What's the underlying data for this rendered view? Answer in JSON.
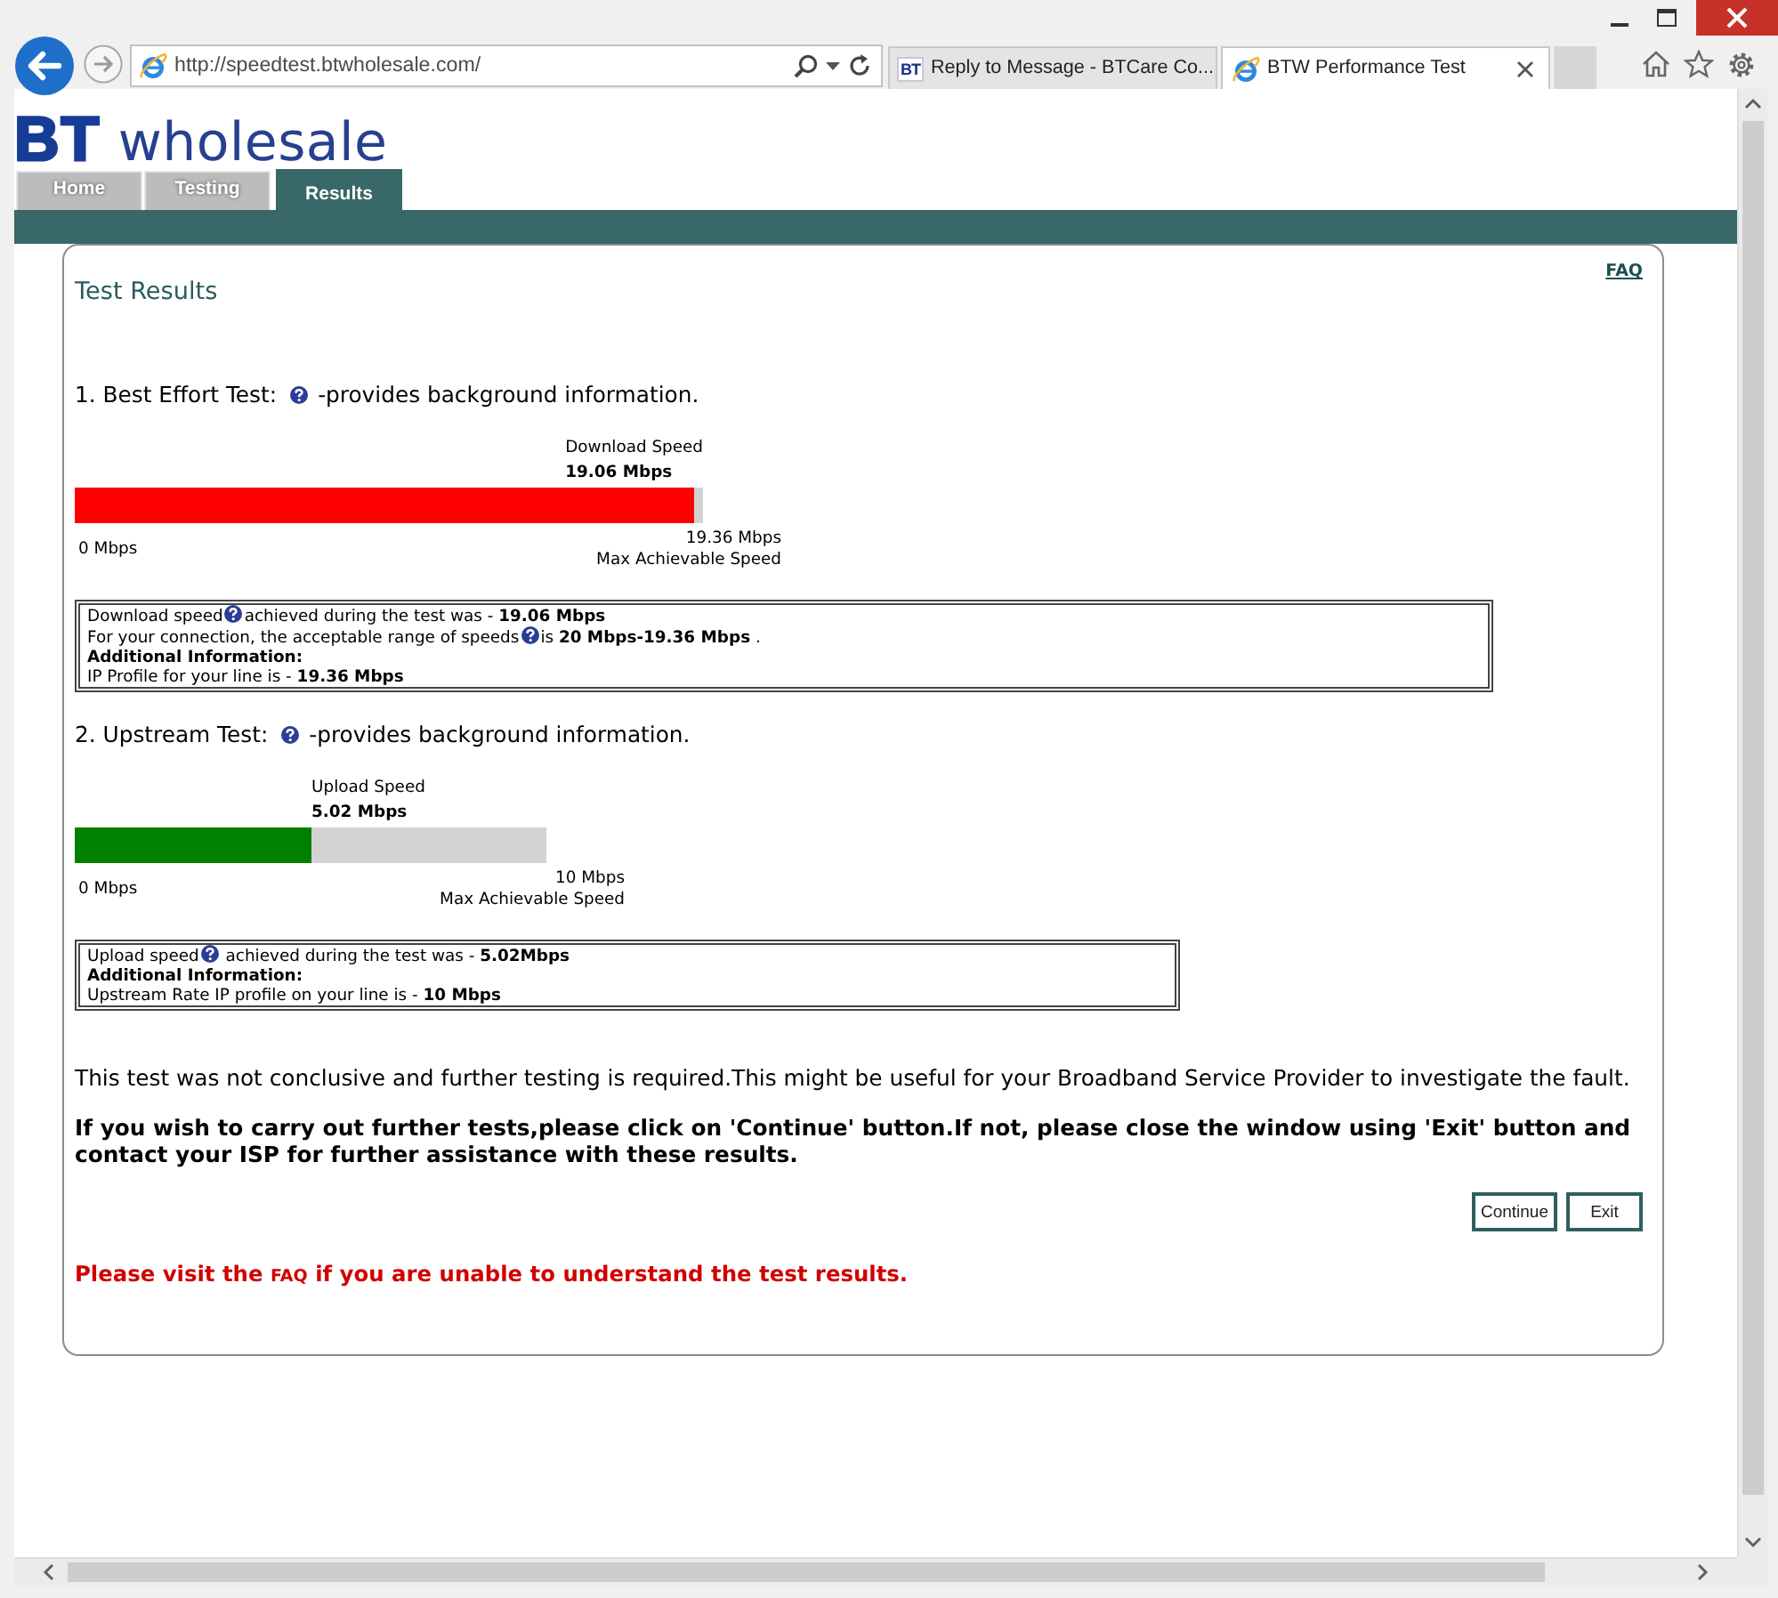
{
  "browser": {
    "address": "http://speedtest.btwholesale.com/",
    "tabs": [
      {
        "favicon": {
          "kind": "text",
          "text": "BT"
        },
        "title": "Reply to Message - BTCare Co...",
        "selected": false
      },
      {
        "favicon": {
          "kind": "browser"
        },
        "title": "BTW Performance Test",
        "selected": true
      }
    ]
  },
  "page": {
    "logo": "**BT** wholesale",
    "nav_tabs": [
      {
        "label": "Home",
        "selected": false
      },
      {
        "label": "Testing",
        "selected": false
      },
      {
        "label": "Results",
        "selected": true
      }
    ],
    "faq_link": "FAQ",
    "title": "Test Results",
    "tests": [
      {
        "heading": "1. Best Effort Test:",
        "description": "-provides background information.",
        "meter": {
          "label": "Download Speed",
          "value": "19.06 Mbps",
          "level": 0.985,
          "color": "#ff0000",
          "min_label": "0 Mbps",
          "max_label": "19.36 Mbps",
          "max_caption": "Max Achievable Speed"
        },
        "details": [
          {
            "kind": "help",
            "before": "Download speed",
            "after": "achieved during the test was - **19.06 Mbps**"
          },
          {
            "kind": "help",
            "before": "For your connection, the acceptable range of speeds",
            "after": "is **20 Mbps-19.36 Mbps** ."
          },
          {
            "kind": "heading",
            "text": "Additional Information:"
          },
          {
            "kind": "plain",
            "text": "IP Profile for your line is - **19.36 Mbps**"
          }
        ]
      },
      {
        "heading": "2. Upstream Test:",
        "description": "-provides background information.",
        "meter": {
          "label": "Upload Speed",
          "value": "5.02 Mbps",
          "level": 0.502,
          "color": "#008000",
          "min_label": "0 Mbps",
          "max_label": "10 Mbps",
          "max_caption": "Max Achievable Speed"
        },
        "details": [
          {
            "kind": "help",
            "before": "Upload speed",
            "after": " achieved during the test was - **5.02Mbps**"
          },
          {
            "kind": "heading",
            "text": "Additional Information:"
          },
          {
            "kind": "plain",
            "text": "Upstream Rate IP profile on your line is - **10 Mbps**"
          }
        ]
      }
    ],
    "conclusion": "This test was not conclusive and further testing is required.This might be useful for your Broadband Service Provider to investigate the fault.",
    "instruction": "If you wish to carry out further tests,please click on 'Continue' button.If not, please close the window using 'Exit' button and contact your ISP for further assistance with these results.",
    "buttons": [
      {
        "label": "Continue"
      },
      {
        "label": "Exit"
      }
    ],
    "faq_note": {
      "before": "Please visit the",
      "link": "FAQ",
      "after": "if you are unable to understand the test results."
    }
  }
}
